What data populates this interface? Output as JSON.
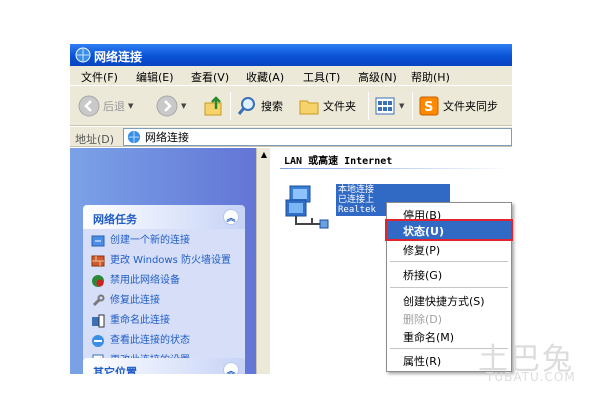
{
  "window": {
    "title": "网络连接"
  },
  "menubar": {
    "items": [
      "文件(F)",
      "编辑(E)",
      "查看(V)",
      "收藏(A)",
      "工具(T)",
      "高级(N)",
      "帮助(H)"
    ]
  },
  "toolbar": {
    "back_label": "后退",
    "search_label": "搜索",
    "folders_label": "文件夹",
    "sync_label": "文件夹同步"
  },
  "address": {
    "label": "地址(D)",
    "value": "网络连接"
  },
  "task_pane": {
    "network_tasks_title": "网络任务",
    "tasks": [
      "创建一个新的连接",
      "更改 Windows 防火墙设置",
      "禁用此网络设备",
      "修复此连接",
      "重命名此连接",
      "查看此连接的状态",
      "更改此连接的设置"
    ],
    "other_places_title": "其它位置"
  },
  "content": {
    "group_header": "LAN 或高速 Internet",
    "connection": {
      "name": "本地连接",
      "status": "已连接上",
      "adapter": "Realtek"
    }
  },
  "context_menu": {
    "items": [
      "停用(B)",
      "状态(U)",
      "修复(P)",
      "桥接(G)",
      "创建快捷方式(S)",
      "删除(D)",
      "重命名(M)",
      "属性(R)"
    ],
    "highlighted": "状态(U)",
    "disabled": [
      "删除(D)"
    ]
  },
  "watermark": {
    "text_cn": "土巴兔",
    "text_en": "TUBATU.COM"
  },
  "colors": {
    "title_bar": "#0a52d6",
    "task_pane": "#6375d6",
    "highlight": "#316ac5",
    "callout": "#e0232d"
  }
}
